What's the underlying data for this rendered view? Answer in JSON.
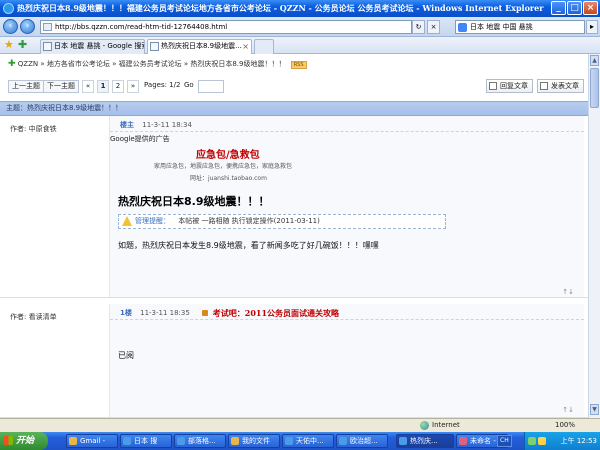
{
  "window": {
    "title": "热烈庆祝日本8.9级地震！！！福建公务员考试论坛地方各省市公考论坛 - QZZN - 公务员论坛 公务员考试论坛 - Windows Internet Explorer",
    "controls": {
      "minimize": "_",
      "maximize": "□",
      "close": "×"
    }
  },
  "address_bar": {
    "url": "http://bbs.qzzn.com/read-htm-tid-12764408.html",
    "search_text": "日本 地震 中国 悬挑",
    "refresh": "↻",
    "stop": "×",
    "go": "▸"
  },
  "tabs": [
    {
      "label": "日本 地震 悬挑 - Google 搜索"
    },
    {
      "label": "热烈庆祝日本8.9级地震...",
      "active": true
    },
    {
      "label": ""
    }
  ],
  "breadcrumb": {
    "site": "QZZN",
    "path": "» 地方各省市公考论坛 » 福建公务员考试论坛 » 热烈庆祝日本8.9级地震！！！",
    "rss": "RSS"
  },
  "pager": {
    "prev_topic": "上一主题",
    "next_topic": "下一主题",
    "first": "«",
    "pages": [
      "1",
      "2"
    ],
    "next": "»",
    "pages_label": "Pages: 1/2",
    "go_label": "Go"
  },
  "actions": {
    "reply": "回复文章",
    "new_post": "发表文章"
  },
  "topic_bar": "主题：热烈庆祝日本8.9级地震！！！",
  "posts": [
    {
      "author": "作者: 中原食铁",
      "floor": "楼主",
      "time": "11-3-11 18:34",
      "ad_label": "Google提供的广告",
      "ad_title": "应急包/急救包",
      "ad_line1": "家用应急包，地震应急包，便携应急包，家庭急救包",
      "ad_line2": "网址：juanshi.taobao.com",
      "title": "热烈庆祝日本8.9级地震！！！",
      "notice_label": "管理提醒：",
      "notice_text": "本帖被 一路相随 执行锁定操作(2011-03-11)",
      "content": "如题，热烈庆祝日本发生8.9级地震，看了新闻多吃了好几碗饭！！！嘿嘿",
      "updown": "↑↓"
    },
    {
      "author": "作者: 看读清单",
      "floor": "1楼",
      "time": "11-3-11 18:35",
      "promo": "考试吧：2011公务员面试通关攻略",
      "content": "已阅",
      "updown": "↑↓"
    }
  ],
  "status_bar": {
    "zone": "Internet",
    "zoom": "100%"
  },
  "taskbar": {
    "start": "开始",
    "items": [
      {
        "label": "Gmail -"
      },
      {
        "label": "日本 搜"
      },
      {
        "label": "部落格..."
      },
      {
        "label": "我的文件"
      },
      {
        "label": "天佑中..."
      },
      {
        "label": "欧治超..."
      },
      {
        "label": "热烈庆...",
        "active": true
      },
      {
        "label": "未命名 -"
      }
    ],
    "lang": "CH",
    "clock": "上午 12:53"
  }
}
